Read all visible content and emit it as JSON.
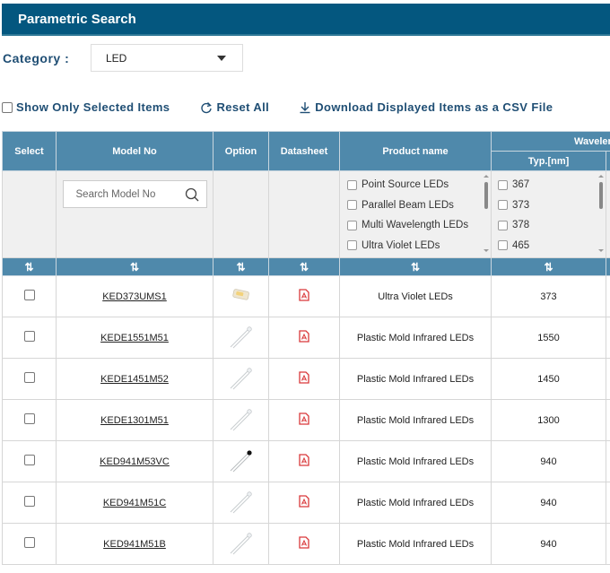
{
  "header": {
    "title": "Parametric Search"
  },
  "category": {
    "label": "Category :",
    "selected": "LED"
  },
  "actions": {
    "show_selected": "Show Only Selected Items",
    "reset_all": "Reset All",
    "download_csv": "Download Displayed Items as a CSV File"
  },
  "table": {
    "columns": {
      "select": "Select",
      "model_no": "Model No",
      "option": "Option",
      "datasheet": "Datasheet",
      "product_name": "Product name",
      "wavelength_group": "Waveler",
      "wavelength_typ": "Typ.[nm]"
    },
    "sort_symbol": "⇅",
    "search_placeholder": "Search Model No",
    "product_filter": [
      "Point Source LEDs",
      "Parallel Beam LEDs",
      "Multi Wavelength LEDs",
      "Ultra Violet LEDs"
    ],
    "wavelength_filter": [
      "367",
      "373",
      "378",
      "465"
    ],
    "rows": [
      {
        "model": "KED373UMS1",
        "image": "smd-led",
        "product": "Ultra Violet LEDs",
        "wavelength": "373"
      },
      {
        "model": "KEDE1551M51",
        "image": "leaded-led-clear",
        "product": "Plastic Mold Infrared LEDs",
        "wavelength": "1550"
      },
      {
        "model": "KEDE1451M52",
        "image": "leaded-led-clear",
        "product": "Plastic Mold Infrared LEDs",
        "wavelength": "1450"
      },
      {
        "model": "KEDE1301M51",
        "image": "leaded-led-clear",
        "product": "Plastic Mold Infrared LEDs",
        "wavelength": "1300"
      },
      {
        "model": "KED941M53VC",
        "image": "leaded-led-black",
        "product": "Plastic Mold Infrared LEDs",
        "wavelength": "940"
      },
      {
        "model": "KED941M51C",
        "image": "leaded-led-clear",
        "product": "Plastic Mold Infrared LEDs",
        "wavelength": "940"
      },
      {
        "model": "KED941M51B",
        "image": "leaded-led-clear",
        "product": "Plastic Mold Infrared LEDs",
        "wavelength": "940"
      }
    ]
  }
}
